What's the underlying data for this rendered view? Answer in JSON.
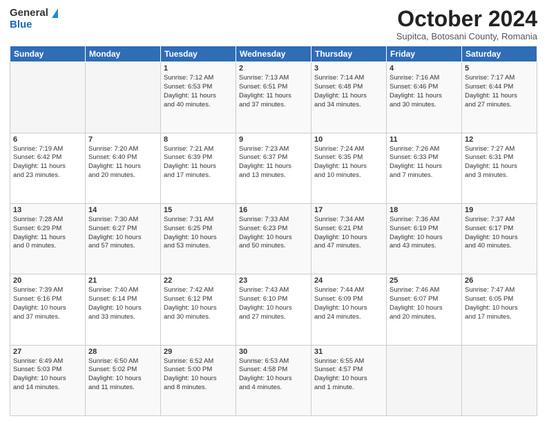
{
  "logo": {
    "line1": "General",
    "line2": "Blue"
  },
  "title": "October 2024",
  "subtitle": "Supitca, Botosani County, Romania",
  "days_of_week": [
    "Sunday",
    "Monday",
    "Tuesday",
    "Wednesday",
    "Thursday",
    "Friday",
    "Saturday"
  ],
  "weeks": [
    [
      {
        "day": "",
        "info": ""
      },
      {
        "day": "",
        "info": ""
      },
      {
        "day": "1",
        "info": "Sunrise: 7:12 AM\nSunset: 6:53 PM\nDaylight: 11 hours\nand 40 minutes."
      },
      {
        "day": "2",
        "info": "Sunrise: 7:13 AM\nSunset: 6:51 PM\nDaylight: 11 hours\nand 37 minutes."
      },
      {
        "day": "3",
        "info": "Sunrise: 7:14 AM\nSunset: 6:48 PM\nDaylight: 11 hours\nand 34 minutes."
      },
      {
        "day": "4",
        "info": "Sunrise: 7:16 AM\nSunset: 6:46 PM\nDaylight: 11 hours\nand 30 minutes."
      },
      {
        "day": "5",
        "info": "Sunrise: 7:17 AM\nSunset: 6:44 PM\nDaylight: 11 hours\nand 27 minutes."
      }
    ],
    [
      {
        "day": "6",
        "info": "Sunrise: 7:19 AM\nSunset: 6:42 PM\nDaylight: 11 hours\nand 23 minutes."
      },
      {
        "day": "7",
        "info": "Sunrise: 7:20 AM\nSunset: 6:40 PM\nDaylight: 11 hours\nand 20 minutes."
      },
      {
        "day": "8",
        "info": "Sunrise: 7:21 AM\nSunset: 6:39 PM\nDaylight: 11 hours\nand 17 minutes."
      },
      {
        "day": "9",
        "info": "Sunrise: 7:23 AM\nSunset: 6:37 PM\nDaylight: 11 hours\nand 13 minutes."
      },
      {
        "day": "10",
        "info": "Sunrise: 7:24 AM\nSunset: 6:35 PM\nDaylight: 11 hours\nand 10 minutes."
      },
      {
        "day": "11",
        "info": "Sunrise: 7:26 AM\nSunset: 6:33 PM\nDaylight: 11 hours\nand 7 minutes."
      },
      {
        "day": "12",
        "info": "Sunrise: 7:27 AM\nSunset: 6:31 PM\nDaylight: 11 hours\nand 3 minutes."
      }
    ],
    [
      {
        "day": "13",
        "info": "Sunrise: 7:28 AM\nSunset: 6:29 PM\nDaylight: 11 hours\nand 0 minutes."
      },
      {
        "day": "14",
        "info": "Sunrise: 7:30 AM\nSunset: 6:27 PM\nDaylight: 10 hours\nand 57 minutes."
      },
      {
        "day": "15",
        "info": "Sunrise: 7:31 AM\nSunset: 6:25 PM\nDaylight: 10 hours\nand 53 minutes."
      },
      {
        "day": "16",
        "info": "Sunrise: 7:33 AM\nSunset: 6:23 PM\nDaylight: 10 hours\nand 50 minutes."
      },
      {
        "day": "17",
        "info": "Sunrise: 7:34 AM\nSunset: 6:21 PM\nDaylight: 10 hours\nand 47 minutes."
      },
      {
        "day": "18",
        "info": "Sunrise: 7:36 AM\nSunset: 6:19 PM\nDaylight: 10 hours\nand 43 minutes."
      },
      {
        "day": "19",
        "info": "Sunrise: 7:37 AM\nSunset: 6:17 PM\nDaylight: 10 hours\nand 40 minutes."
      }
    ],
    [
      {
        "day": "20",
        "info": "Sunrise: 7:39 AM\nSunset: 6:16 PM\nDaylight: 10 hours\nand 37 minutes."
      },
      {
        "day": "21",
        "info": "Sunrise: 7:40 AM\nSunset: 6:14 PM\nDaylight: 10 hours\nand 33 minutes."
      },
      {
        "day": "22",
        "info": "Sunrise: 7:42 AM\nSunset: 6:12 PM\nDaylight: 10 hours\nand 30 minutes."
      },
      {
        "day": "23",
        "info": "Sunrise: 7:43 AM\nSunset: 6:10 PM\nDaylight: 10 hours\nand 27 minutes."
      },
      {
        "day": "24",
        "info": "Sunrise: 7:44 AM\nSunset: 6:09 PM\nDaylight: 10 hours\nand 24 minutes."
      },
      {
        "day": "25",
        "info": "Sunrise: 7:46 AM\nSunset: 6:07 PM\nDaylight: 10 hours\nand 20 minutes."
      },
      {
        "day": "26",
        "info": "Sunrise: 7:47 AM\nSunset: 6:05 PM\nDaylight: 10 hours\nand 17 minutes."
      }
    ],
    [
      {
        "day": "27",
        "info": "Sunrise: 6:49 AM\nSunset: 5:03 PM\nDaylight: 10 hours\nand 14 minutes."
      },
      {
        "day": "28",
        "info": "Sunrise: 6:50 AM\nSunset: 5:02 PM\nDaylight: 10 hours\nand 11 minutes."
      },
      {
        "day": "29",
        "info": "Sunrise: 6:52 AM\nSunset: 5:00 PM\nDaylight: 10 hours\nand 8 minutes."
      },
      {
        "day": "30",
        "info": "Sunrise: 6:53 AM\nSunset: 4:58 PM\nDaylight: 10 hours\nand 4 minutes."
      },
      {
        "day": "31",
        "info": "Sunrise: 6:55 AM\nSunset: 4:57 PM\nDaylight: 10 hours\nand 1 minute."
      },
      {
        "day": "",
        "info": ""
      },
      {
        "day": "",
        "info": ""
      }
    ]
  ]
}
